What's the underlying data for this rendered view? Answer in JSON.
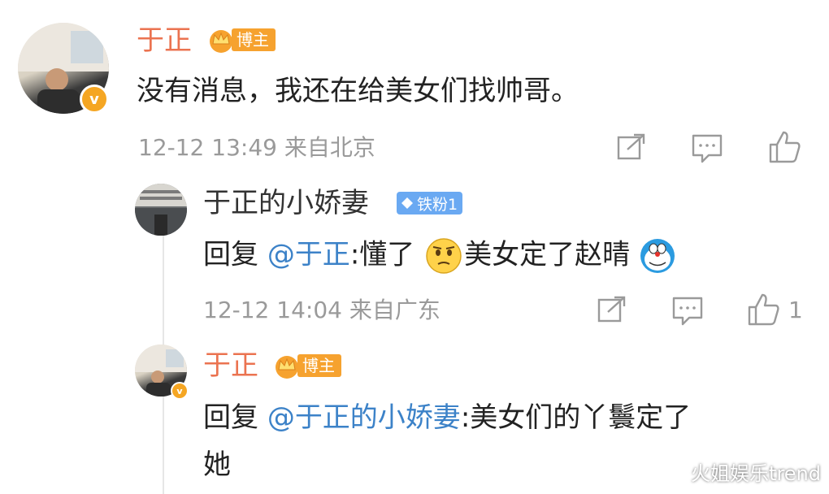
{
  "comment": {
    "author": "于正",
    "badge": "博主",
    "text": "没有消息，我还在给美女们找帅哥。",
    "time": "12-12 13:49",
    "source": "来自北京"
  },
  "reply1": {
    "author": "于正的小娇妻",
    "badge": "铁粉1",
    "prefix": "回复 ",
    "mention": "@于正",
    "colon": ":",
    "text_a": "懂了",
    "text_b": "美女定了赵晴",
    "time": "12-12 14:04",
    "source": "来自广东",
    "like_count": "1"
  },
  "reply2": {
    "author": "于正",
    "badge": "博主",
    "prefix": "回复 ",
    "mention": "@于正的小娇妻",
    "colon": ":",
    "text_line1": "美女们的丫鬟定了",
    "text_line2": "她"
  },
  "watermark": "火姐娱乐trend",
  "icons": {
    "share": "share-icon",
    "comment": "comment-icon",
    "like": "thumbs-up-icon",
    "verified": "verified-v-icon",
    "crown": "crown-icon",
    "diamond": "diamond-icon"
  },
  "colors": {
    "name": "#eb7350",
    "mention": "#3c82c8",
    "meta": "#9a9a9a",
    "badge_orange": "#f6a22f",
    "badge_blue": "#6aa9f2"
  }
}
